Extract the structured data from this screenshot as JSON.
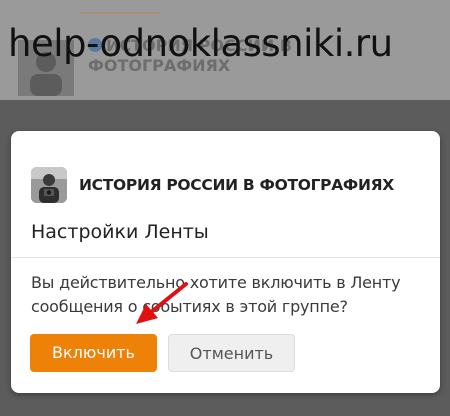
{
  "watermark": "help-odnoklassniki.ru",
  "background": {
    "group_title": "ИСТОРИЯ РОССИИ В ФОТОГРАФИЯХ"
  },
  "dialog": {
    "group_name": "ИСТОРИЯ РОССИИ В ФОТОГРАФИЯХ",
    "title": "Настройки Ленты",
    "message": "Вы действительно хотите включить в Ленту сообщения о событиях в этой группе?",
    "confirm_label": "Включить",
    "cancel_label": "Отменить"
  },
  "colors": {
    "accent": "#ee8208",
    "annotation_arrow": "#e01010"
  },
  "icons": {
    "group_avatar": "group-avatar-photo-icon",
    "verified": "verified-check-icon",
    "arrow": "red-annotation-arrow"
  }
}
